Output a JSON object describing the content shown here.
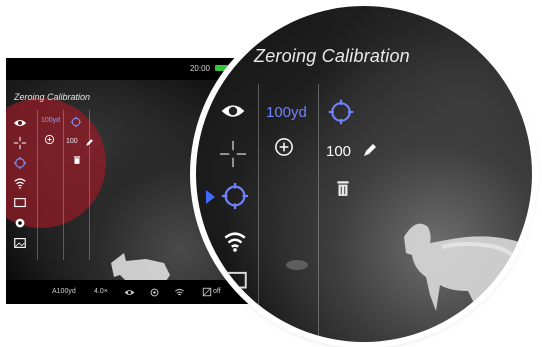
{
  "screen": {
    "time": "20:00",
    "title": "Zeroing Calibration",
    "distance": "100yd",
    "value": "100",
    "status_bar": {
      "distance": "A100yd",
      "zoom": "4.0×",
      "pip_off": "off"
    }
  },
  "zoom_view": {
    "title": "Zeroing Calibration",
    "distance": "100yd",
    "value": "100"
  },
  "icons": {
    "eye": "eye-icon",
    "crosshair": "crosshair-icon",
    "target": "target-icon",
    "wifi": "wifi-icon",
    "screen": "screen-icon",
    "settings": "settings-icon",
    "image": "image-icon",
    "pen": "pen-icon",
    "trash": "trash-icon",
    "plus": "plus-icon"
  },
  "colors": {
    "accent_blue": "#6f83ff",
    "battery_green": "#36c43f",
    "overlay_red": "#961a26"
  }
}
